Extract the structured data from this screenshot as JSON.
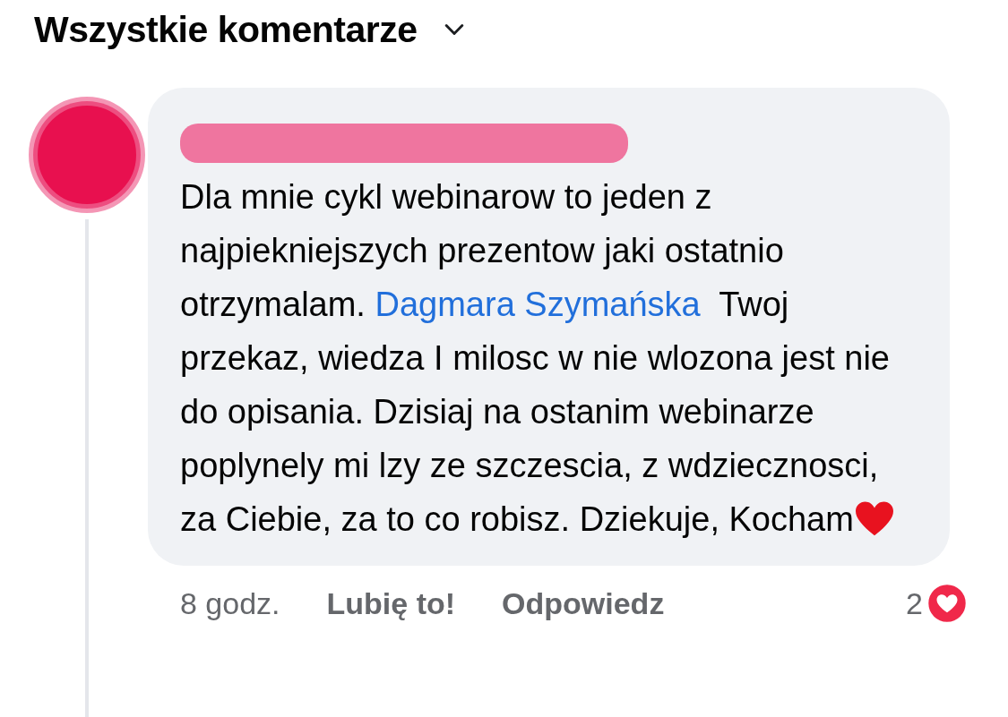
{
  "header": {
    "title": "Wszystkie komentarze"
  },
  "comment": {
    "parts": [
      {
        "kind": "text",
        "text": "Dla mnie cykl webinarow to jeden z najpiekniejszych prezentow jaki ostatnio otrzymalam. "
      },
      {
        "kind": "mention",
        "text": "Dagmara Szymańska"
      },
      {
        "kind": "text",
        "text": "  Twoj przekaz, wiedza I milosc w nie wlozona jest nie do opisania. Dzisiaj na ostanim webinarze  poplynely mi lzy ze szczescia, z wdziecznosci, za Ciebie, za to co robisz. Dziekuje, Kocham"
      },
      {
        "kind": "heart"
      }
    ],
    "time": "8 godz.",
    "actions": [
      "Lubię to!",
      "Odpowiedz"
    ],
    "reaction_count": "2"
  }
}
